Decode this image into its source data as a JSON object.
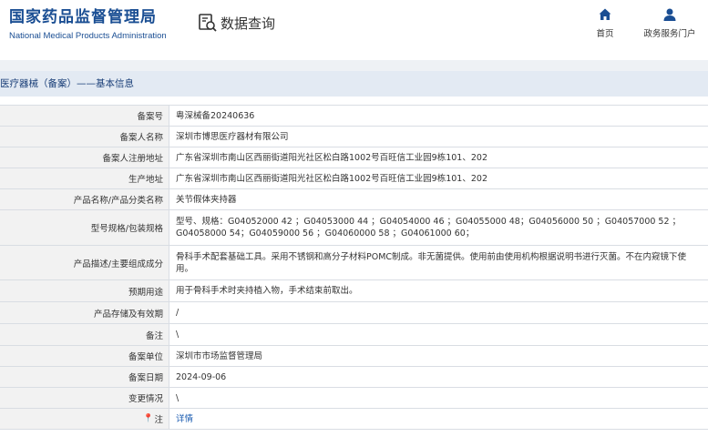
{
  "header": {
    "logo_cn": "国家药品监督管理局",
    "logo_en": "National Medical Products Administration",
    "query_title": "数据查询",
    "nav": [
      {
        "label": "首页",
        "icon": "home-icon"
      },
      {
        "label": "政务服务门户",
        "icon": "user-icon"
      }
    ]
  },
  "section_title": "医疗器械（备案）——基本信息",
  "rows": [
    {
      "label": "备案号",
      "value": "粤深械备20240636"
    },
    {
      "label": "备案人名称",
      "value": "深圳市博思医疗器材有限公司"
    },
    {
      "label": "备案人注册地址",
      "value": "广东省深圳市南山区西丽街道阳光社区松白路1002号百旺信工业园9栋101、202"
    },
    {
      "label": "生产地址",
      "value": "广东省深圳市南山区西丽街道阳光社区松白路1002号百旺信工业园9栋101、202"
    },
    {
      "label": "产品名称/产品分类名称",
      "value": "关节假体夹持器"
    },
    {
      "label": "型号规格/包装规格",
      "value": "型号、规格：G04052000 42 ；G04053000 44 ；G04054000 46 ；G04055000 48；G04056000 50 ；G04057000 52 ；G04058000 54；G04059000 56 ；G04060000 58 ；G04061000 60；"
    },
    {
      "label": "产品描述/主要组成成分",
      "value": "骨科手术配套基础工具。采用不锈钢和高分子材料POMC制成。非无菌提供。使用前由使用机构根据说明书进行灭菌。不在内窥镜下使用。"
    },
    {
      "label": "预期用途",
      "value": "用于骨科手术时夹持植入物，手术结束前取出。"
    },
    {
      "label": "产品存储及有效期",
      "value": "/"
    },
    {
      "label": "备注",
      "value": "\\"
    },
    {
      "label": "备案单位",
      "value": "深圳市市场监督管理局"
    },
    {
      "label": "备案日期",
      "value": "2024-09-06"
    },
    {
      "label": "变更情况",
      "value": "\\"
    }
  ],
  "note_row": {
    "label": "注",
    "link": "详情",
    "icon": "pin-icon"
  },
  "colors": {
    "brand": "#1a4e93",
    "link": "#1a5bb0",
    "label_bg": "#f2f2f2",
    "section_bg": "#e3eaf3"
  }
}
